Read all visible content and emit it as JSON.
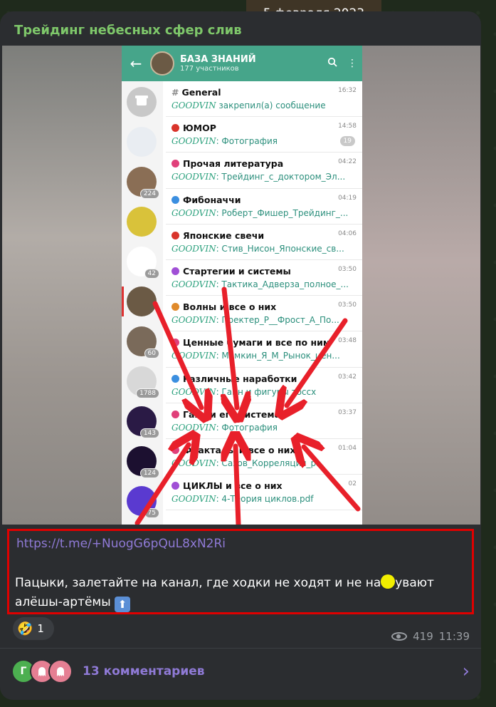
{
  "date": "5 февраля 2023",
  "channel": {
    "name": "Трейдинг небесных сфер слив",
    "color": "#7ec76a"
  },
  "screenshot": {
    "header": {
      "title": "БАЗА ЗНАНИЙ",
      "subtitle": "177 участников",
      "back_icon": "arrow-left-icon",
      "search_icon": "search-icon",
      "menu_icon": "more-vert-icon"
    },
    "sidebar": [
      {
        "count": ""
      },
      {
        "count": ""
      },
      {
        "count": "224"
      },
      {
        "count": ""
      },
      {
        "count": "42"
      },
      {
        "count": ""
      },
      {
        "count": "60"
      },
      {
        "count": "1788"
      },
      {
        "count": "143"
      },
      {
        "count": "124"
      },
      {
        "count": "75"
      }
    ],
    "topics": [
      {
        "name": "General",
        "prefix": "#",
        "time": "16:32",
        "who": "GOODVIN",
        "text": " закрепил(а) сообщение",
        "badge": "",
        "color": ""
      },
      {
        "name": "ЮМОР",
        "time": "14:58",
        "who": "GOODVIN",
        "text": ": Фотография",
        "badge": "19",
        "color": "#d9342b"
      },
      {
        "name": "Прочая литература",
        "time": "04:22",
        "who": "GOODVIN",
        "text": ": Трейдинг_с_доктором_Эл...",
        "badge": "",
        "color": "#e0407a"
      },
      {
        "name": "Фибоначчи",
        "time": "04:19",
        "who": "GOODVIN",
        "text": ": Роберт_Фишер_Трейдинг_...",
        "badge": "",
        "color": "#3b8fe0"
      },
      {
        "name": "Японские свечи",
        "time": "04:06",
        "who": "GOODVIN",
        "text": ": Стив_Нисон_Японские_св...",
        "badge": "",
        "color": "#d9342b"
      },
      {
        "name": "Стартегии и системы",
        "time": "03:50",
        "who": "GOODVIN",
        "text": ": Тактика_Адверза_полное_...",
        "badge": "",
        "color": "#a04fd6"
      },
      {
        "name": "Волны и все о них",
        "time": "03:50",
        "who": "GOODVIN",
        "text": ": Пректер_Р__Фрост_А_По...",
        "badge": "",
        "color": "#e08a2b"
      },
      {
        "name": "Ценные бумаги и все по ним",
        "time": "03:48",
        "who": "GOODVIN",
        "text": ": Мамкин_Я_М_Рынок_цен...",
        "badge": "",
        "color": "#e0407a"
      },
      {
        "name": "Различные наработки",
        "time": "03:42",
        "who": "GOODVIN",
        "text": ": Ганн и фигуры тоссх",
        "badge": "",
        "color": "#3b8fe0"
      },
      {
        "name": "Ганн и его система",
        "time": "03:37",
        "who": "GOODVIN",
        "text": ": Фотография",
        "badge": "",
        "color": "#e0407a"
      },
      {
        "name": "Фракталы и все о них",
        "time": "01:04",
        "who": "GOODVIN",
        "text": ": Сазов_Корреляция_р...",
        "badge": "",
        "color": "#e0407a"
      },
      {
        "name": "ЦИКЛЫ и все о них",
        "time": "02",
        "who": "GOODVIN",
        "text": ": 4-Теория циклов.pdf",
        "badge": "",
        "color": "#a04fd6"
      }
    ]
  },
  "message": {
    "link": "https://t.me/+NuogG6pQuL8xN2Ri",
    "text_before": "Пацыки, залетайте на канал, где ходки не ходят и не на",
    "text_after": "увают алёшы-артёмы",
    "up_icon": "arrow-up-emoji-icon"
  },
  "reaction": {
    "emoji": "🤣",
    "count": "1"
  },
  "views": "419",
  "time": "11:39",
  "comments": {
    "avatars": [
      "Г",
      "",
      ""
    ],
    "label": "13 комментариев"
  }
}
